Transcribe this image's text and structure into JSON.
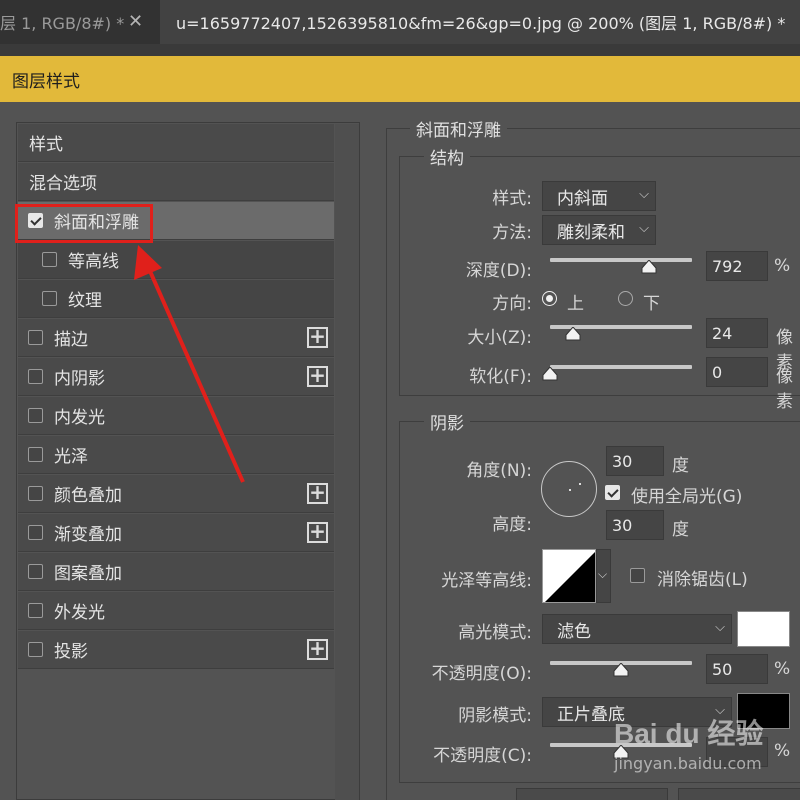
{
  "tabs": [
    {
      "label": "层 1, RGB/8#) *",
      "close": "✕"
    },
    {
      "label": "u=1659772407,1526395810&fm=26&gp=0.jpg @ 200% (图层 1, RGB/8#) *"
    }
  ],
  "dialog": {
    "title": "图层样式"
  },
  "style_list": [
    {
      "label": "样式",
      "type": "header"
    },
    {
      "label": "混合选项",
      "type": "header"
    },
    {
      "label": "斜面和浮雕",
      "checked": true,
      "selected": true,
      "plus": false
    },
    {
      "label": "等高线",
      "checked": false,
      "sub": true,
      "plus": false
    },
    {
      "label": "纹理",
      "checked": false,
      "sub": true,
      "plus": false
    },
    {
      "label": "描边",
      "checked": false,
      "plus": true
    },
    {
      "label": "内阴影",
      "checked": false,
      "plus": true
    },
    {
      "label": "内发光",
      "checked": false,
      "plus": false
    },
    {
      "label": "光泽",
      "checked": false,
      "plus": false
    },
    {
      "label": "颜色叠加",
      "checked": false,
      "plus": true
    },
    {
      "label": "渐变叠加",
      "checked": false,
      "plus": true
    },
    {
      "label": "图案叠加",
      "checked": false,
      "plus": false
    },
    {
      "label": "外发光",
      "checked": false,
      "plus": false
    },
    {
      "label": "投影",
      "checked": false,
      "plus": true
    }
  ],
  "bevel": {
    "section_title": "斜面和浮雕",
    "structure_title": "结构",
    "style_label": "样式:",
    "style_value": "内斜面",
    "technique_label": "方法:",
    "technique_value": "雕刻柔和",
    "depth_label": "深度(D):",
    "depth_value": "792",
    "depth_unit": "%",
    "depth_level": 0.7,
    "direction_label": "方向:",
    "direction_up": "上",
    "direction_down": "下",
    "size_label": "大小(Z):",
    "size_value": "24",
    "size_unit": "像素",
    "size_level": 0.16,
    "soften_label": "软化(F):",
    "soften_value": "0",
    "soften_unit": "像素",
    "soften_level": 0.0
  },
  "shading": {
    "title": "阴影",
    "angle_label": "角度(N):",
    "angle_value": "30",
    "angle_unit": "度",
    "global_light_label": "使用全局光(G)",
    "global_light_checked": true,
    "altitude_label": "高度:",
    "altitude_value": "30",
    "altitude_unit": "度",
    "gloss_contour_label": "光泽等高线:",
    "anti_alias_label": "消除锯齿(L)",
    "anti_alias_checked": false,
    "highlight_mode_label": "高光模式:",
    "highlight_mode_value": "滤色",
    "highlight_color": "#ffffff",
    "highlight_opacity_label": "不透明度(O):",
    "highlight_opacity_value": "50",
    "highlight_opacity_unit": "%",
    "highlight_opacity_level": 0.5,
    "shadow_mode_label": "阴影模式:",
    "shadow_mode_value": "正片叠底",
    "shadow_color": "#000000",
    "shadow_opacity_label": "不透明度(C):",
    "shadow_opacity_unit": "%",
    "shadow_opacity_level": 0.5
  },
  "watermark": {
    "logo": "Bai du 经验",
    "url": "jingyan.baidu.com"
  },
  "colors": {
    "title_bar": "#e2b93a",
    "annotation": "#e0201b"
  }
}
